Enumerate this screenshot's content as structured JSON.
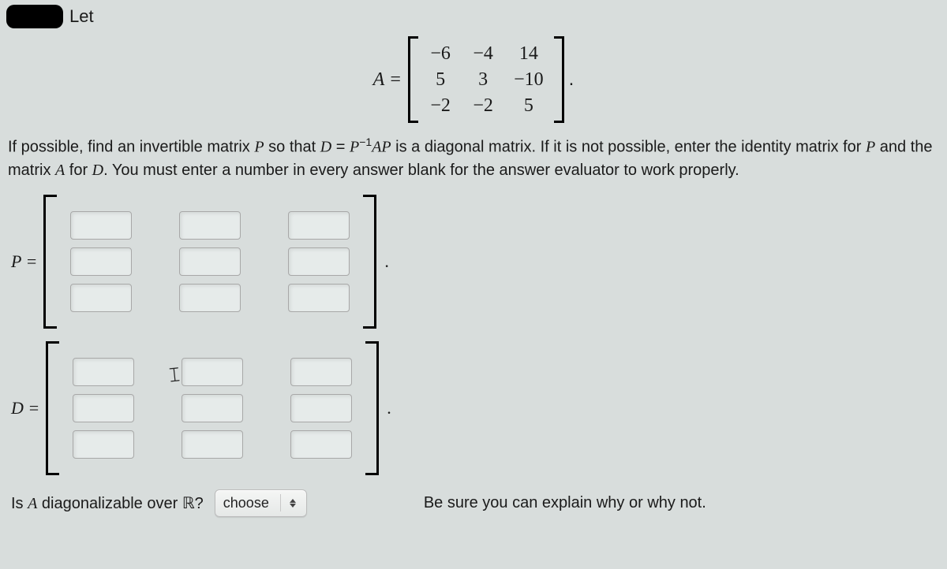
{
  "let_label": "Let",
  "matrixA": {
    "label": "A =",
    "rows": [
      [
        "−6",
        "−4",
        "14"
      ],
      [
        "5",
        "3",
        "−10"
      ],
      [
        "−2",
        "−2",
        "5"
      ]
    ]
  },
  "prompt": {
    "part1": "If possible, find an invertible matrix ",
    "P": "P",
    "part2": " so that ",
    "D": "D",
    "eq": " = ",
    "Pinv": "P",
    "supNeg1": "−1",
    "AP": "AP",
    "part3": " is a diagonal matrix. If it is not possible, enter the identity matrix for ",
    "part4": " and the matrix ",
    "A": "A",
    "part5": " for ",
    "part6": ". You must enter a number in every answer blank for the answer evaluator to work properly."
  },
  "P_label": "P =",
  "D_label": "D =",
  "question": {
    "part1": "Is ",
    "A": "A",
    "part2": " diagonalizable over ",
    "R": "ℝ",
    "qmark": "?"
  },
  "select_value": "choose",
  "tail_text": "Be sure you can explain why or why not."
}
